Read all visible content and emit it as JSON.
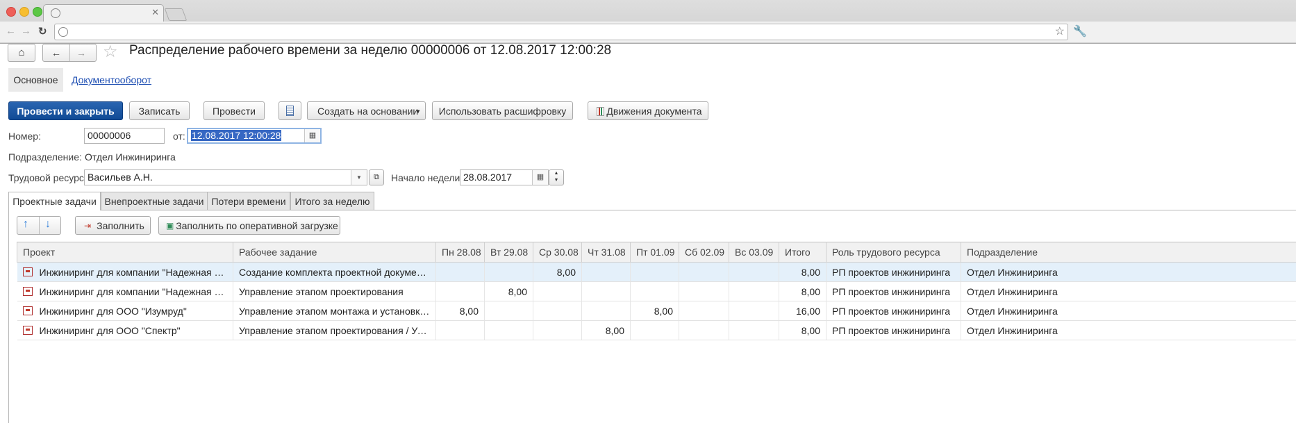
{
  "app": {
    "title": "Распределение рабочего времени за неделю 00000006 от 12.08.2017 12:00:28"
  },
  "subtabs": {
    "main": "Основное",
    "docflow": "Документооборот"
  },
  "toolbar": {
    "post_close": "Провести и закрыть",
    "save": "Записать",
    "post": "Провести",
    "create_based": "Создать на основании",
    "use_decode": "Использовать расшифровку",
    "doc_moves": "Движения документа"
  },
  "form": {
    "number_label": "Номер:",
    "number_value": "00000006",
    "from_label": "от:",
    "date_value": "12.08.2017 12:00:28",
    "dept_label": "Подразделение:",
    "dept_value": "Отдел Инжиниринга",
    "resource_label": "Трудовой ресурс:",
    "resource_value": "Васильев А.Н.",
    "week_label": "Начало недели:",
    "week_value": "28.08.2017"
  },
  "tabs": [
    "Проектные задачи",
    "Внепроектные задачи",
    "Потери времени",
    "Итого за неделю"
  ],
  "table_toolbar": {
    "fill": "Заполнить",
    "fill_by_load": "Заполнить по оперативной загрузке"
  },
  "table": {
    "columns": [
      "Проект",
      "Рабочее задание",
      "Пн 28.08",
      "Вт 29.08",
      "Ср 30.08",
      "Чт 31.08",
      "Пт 01.09",
      "Сб 02.09",
      "Вс 03.09",
      "Итого",
      "Роль трудового ресурса",
      "Подразделение"
    ],
    "rows": [
      [
        "Инжиниринг для компании \"Надежная опо...",
        "Создание комплекта проектной документа...",
        "",
        "",
        "8,00",
        "",
        "",
        "",
        "",
        "8,00",
        "РП проектов инжиниринга",
        "Отдел Инжиниринга"
      ],
      [
        "Инжиниринг для компании \"Надежная опо...",
        "Управление этапом проектирования",
        "",
        "8,00",
        "",
        "",
        "",
        "",
        "",
        "8,00",
        "РП проектов инжиниринга",
        "Отдел Инжиниринга"
      ],
      [
        "Инжиниринг для ООО \"Изумруд\"",
        "Управление этапом монтажа и установки с...",
        "8,00",
        "",
        "",
        "",
        "8,00",
        "",
        "",
        "16,00",
        "РП проектов инжиниринга",
        "Отдел Инжиниринга"
      ],
      [
        "Инжиниринг для ООО \"Спектр\"",
        "Управление этапом проектирования / Упра...",
        "",
        "",
        "",
        "8,00",
        "",
        "",
        "",
        "8,00",
        "РП проектов инжиниринга",
        "Отдел Инжиниринга"
      ]
    ]
  }
}
